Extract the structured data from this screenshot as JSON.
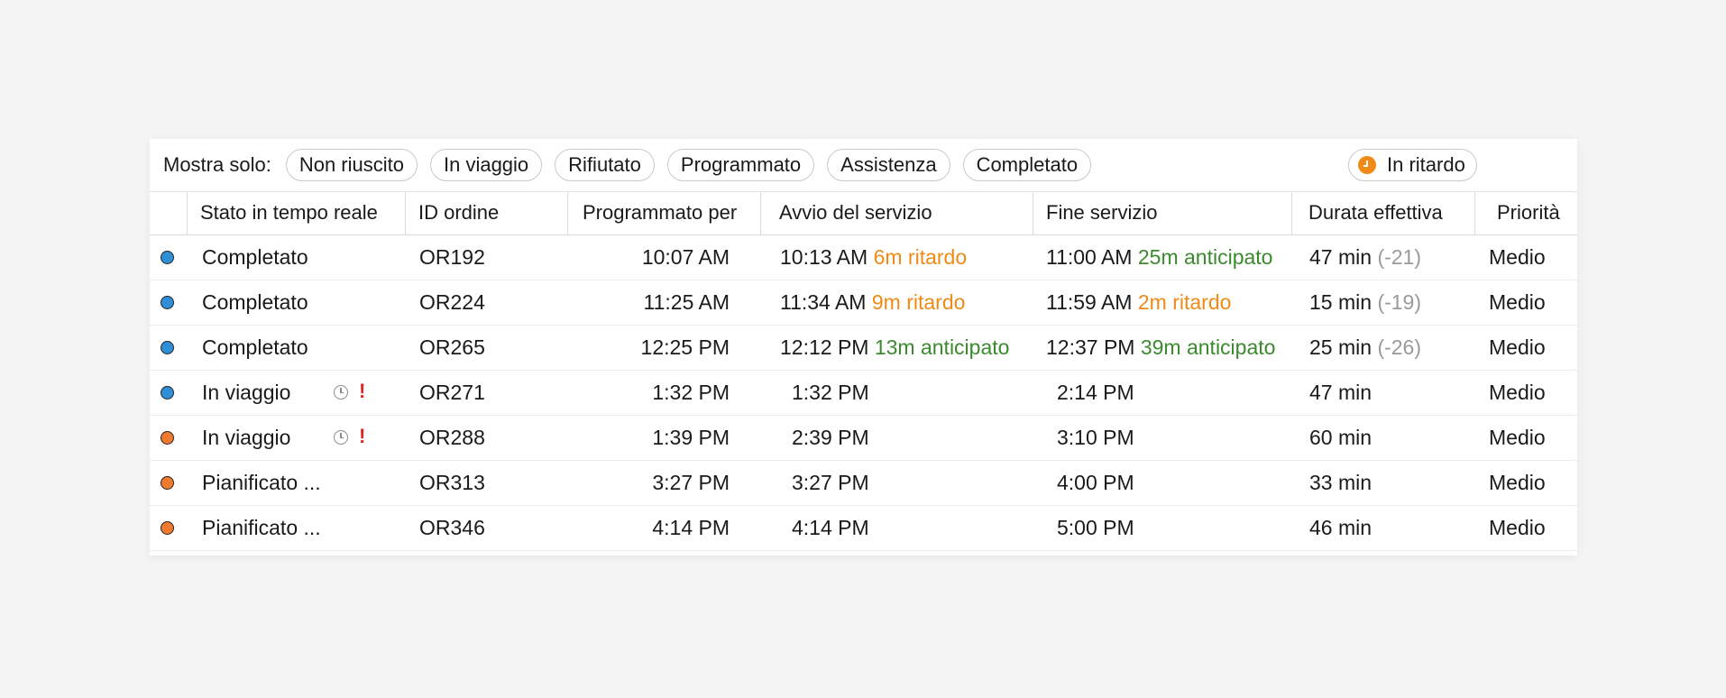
{
  "filters": {
    "label": "Mostra solo:",
    "chips": [
      "Non riuscito",
      "In viaggio",
      "Rifiutato",
      "Programmato",
      "Assistenza",
      "Completato"
    ],
    "late_chip": {
      "label": "In ritardo",
      "icon": "clock-icon",
      "color": "#ef8a17"
    }
  },
  "columns": {
    "status": "Stato in tempo reale",
    "order_id": "ID ordine",
    "scheduled": "Programmato per",
    "start": "Avvio del servizio",
    "end": "Fine servizio",
    "duration": "Durata effettiva",
    "priority": "Priorità"
  },
  "colors": {
    "blue_dot": "#2f8fd6",
    "orange_dot": "#ef7a2e",
    "late": "#ef8a17",
    "early": "#3b8a2e"
  },
  "rows": [
    {
      "dot": "blue",
      "status": "Completato",
      "order_id": "OR192",
      "scheduled": "10:07 AM",
      "start": "10:13 AM",
      "start_note": "6m ritardo",
      "end": "11:00 AM",
      "end_note": "25m anticipato",
      "duration": "47 min",
      "duration_delta": "(-21)",
      "priority": "Medio"
    },
    {
      "dot": "blue",
      "status": "Completato",
      "order_id": "OR224",
      "scheduled": "11:25 AM",
      "start": "11:34 AM",
      "start_note": "9m ritardo",
      "end": "11:59 AM",
      "end_note": "2m ritardo",
      "duration": "15 min",
      "duration_delta": "(-19)",
      "priority": "Medio"
    },
    {
      "dot": "blue",
      "status": "Completato",
      "order_id": "OR265",
      "scheduled": "12:25 PM",
      "start": "12:12 PM",
      "start_note": "13m anticipato",
      "end": "12:37 PM",
      "end_note": "39m anticipato",
      "duration": "25 min",
      "duration_delta": "(-26)",
      "priority": "Medio"
    },
    {
      "dot": "blue",
      "status": "In viaggio",
      "order_id": "OR271",
      "scheduled": "1:32 PM",
      "start": "1:32 PM",
      "end": "2:14 PM",
      "duration": "47 min",
      "priority": "Medio",
      "icons": [
        "clock-icon",
        "alert-icon"
      ]
    },
    {
      "dot": "orange",
      "status": "In viaggio",
      "order_id": "OR288",
      "scheduled": "1:39 PM",
      "start": "2:39 PM",
      "end": "3:10 PM",
      "duration": "60 min",
      "priority": "Medio",
      "icons": [
        "clock-icon",
        "alert-icon"
      ]
    },
    {
      "dot": "orange",
      "status": "Pianificato ...",
      "order_id": "OR313",
      "scheduled": "3:27 PM",
      "start": "3:27 PM",
      "end": "4:00 PM",
      "duration": "33 min",
      "priority": "Medio"
    },
    {
      "dot": "orange",
      "status": "Pianificato ...",
      "order_id": "OR346",
      "scheduled": "4:14 PM",
      "start": "4:14 PM",
      "end": "5:00 PM",
      "duration": "46 min",
      "priority": "Medio"
    }
  ]
}
